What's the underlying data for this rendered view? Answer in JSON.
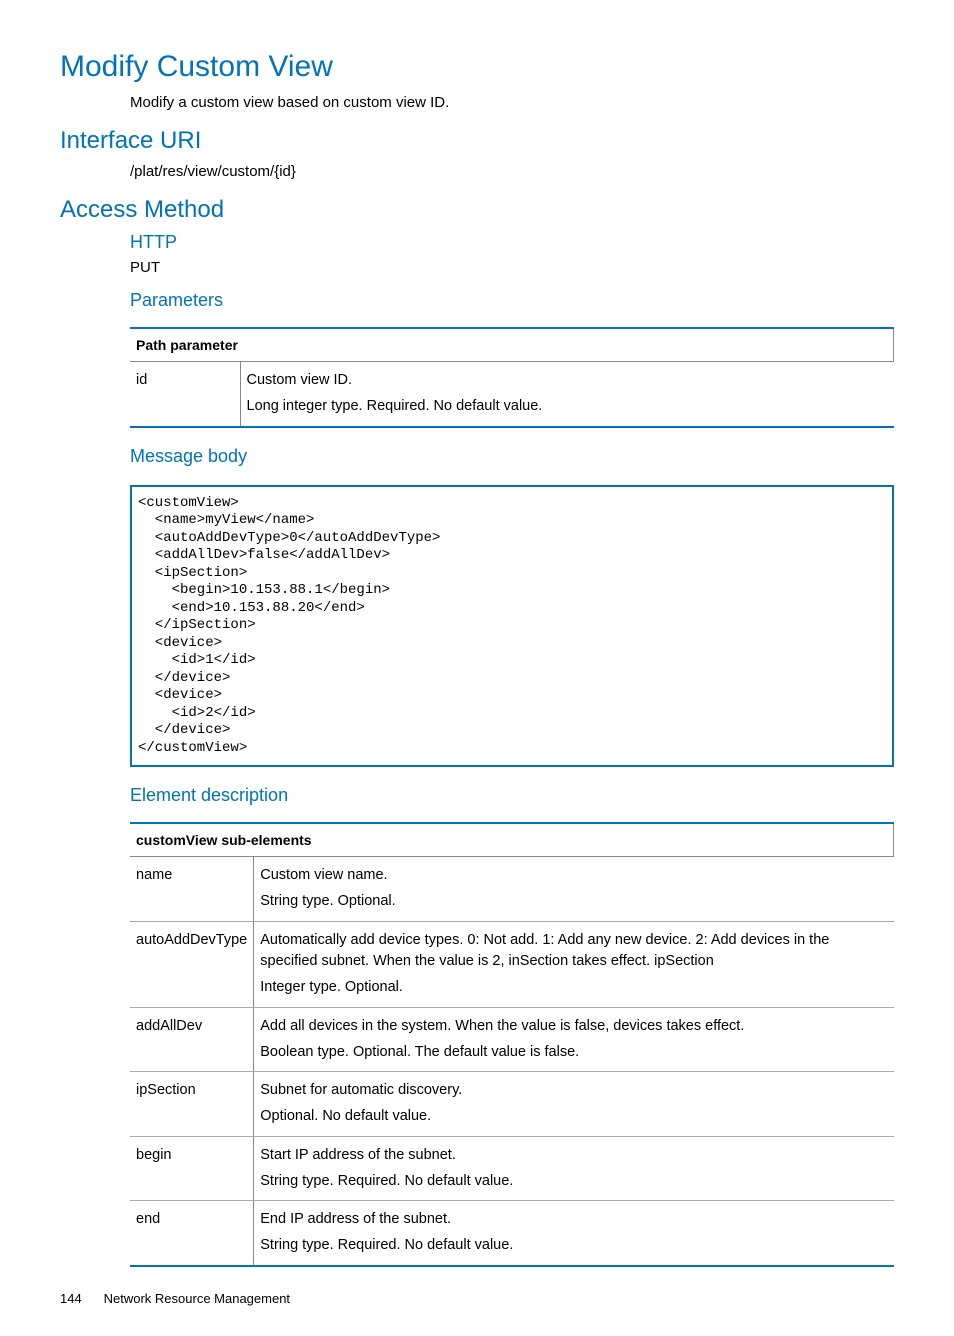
{
  "title": "Modify Custom View",
  "intro": "Modify a custom view based on custom view ID.",
  "interfaceUri": {
    "heading": "Interface URI",
    "value": "/plat/res/view/custom/{id}"
  },
  "accessMethod": {
    "heading": "Access Method",
    "http": {
      "heading": "HTTP",
      "method": "PUT"
    },
    "parameters": {
      "heading": "Parameters",
      "tableHeader1": "Path parameter",
      "tableHeader2": "",
      "rows": [
        {
          "name": "id",
          "desc1": "Custom view ID.",
          "desc2": "Long integer type. Required. No default value."
        }
      ]
    },
    "messageBody": {
      "heading": "Message body",
      "code": "<customView>\n  <name>myView</name>\n  <autoAddDevType>0</autoAddDevType>\n  <addAllDev>false</addAllDev>\n  <ipSection>\n    <begin>10.153.88.1</begin>\n    <end>10.153.88.20</end>\n  </ipSection>\n  <device>\n    <id>1</id>\n  </device>\n  <device>\n    <id>2</id>\n  </device>\n</customView>"
    },
    "elementDescription": {
      "heading": "Element description",
      "tableHeader1": "customView sub-elements",
      "tableHeader2": "",
      "rows": [
        {
          "name": "name",
          "desc1": "Custom view name.",
          "desc2": "String type. Optional."
        },
        {
          "name": "autoAddDevType",
          "desc1": "Automatically add device types. 0: Not add. 1: Add any new device. 2: Add devices in the specified subnet. When the value is 2, inSection takes effect. ipSection",
          "desc2": "Integer type. Optional."
        },
        {
          "name": "addAllDev",
          "desc1": "Add all devices in the system. When the value is false, devices takes effect.",
          "desc2": "Boolean type. Optional. The default value is false."
        },
        {
          "name": "ipSection",
          "desc1": "Subnet for automatic discovery.",
          "desc2": "Optional. No default value."
        },
        {
          "name": "begin",
          "desc1": "Start IP address of the subnet.",
          "desc2": "String type. Required. No default value."
        },
        {
          "name": "end",
          "desc1": "End IP address of the subnet.",
          "desc2": "String type. Required. No default value."
        }
      ]
    }
  },
  "footer": {
    "page": "144",
    "section": "Network Resource Management"
  }
}
